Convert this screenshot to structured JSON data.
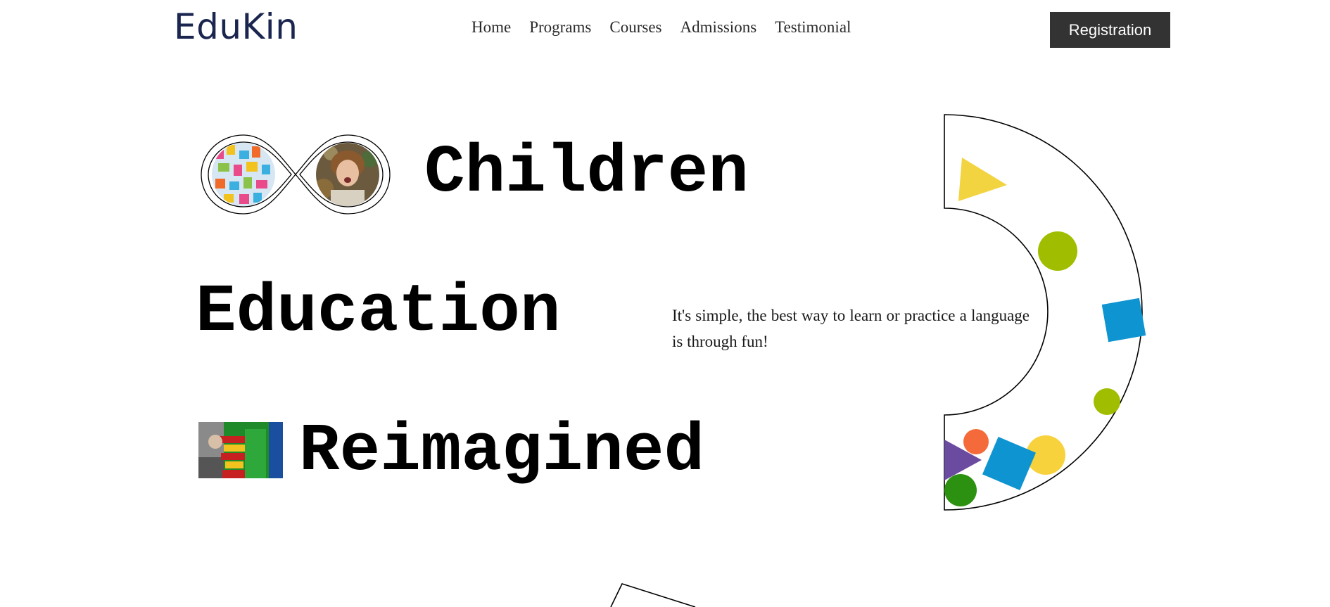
{
  "header": {
    "logo": "EduKin",
    "nav": [
      "Home",
      "Programs",
      "Courses",
      "Admissions",
      "Testimonial"
    ],
    "cta": "Registration"
  },
  "hero": {
    "line1": "Children",
    "line2": "Education",
    "line3": "Reimagined",
    "tagline": "It's simple, the best way to learn or practice a language is through fun!"
  },
  "colors": {
    "dark": "#333333",
    "logo": "#1a2550",
    "yellow": "#f2d340",
    "lime": "#a0bd00",
    "blue": "#0e94d0",
    "purple": "#6b4ba0",
    "orange": "#f56a3a",
    "green": "#2c9110"
  }
}
